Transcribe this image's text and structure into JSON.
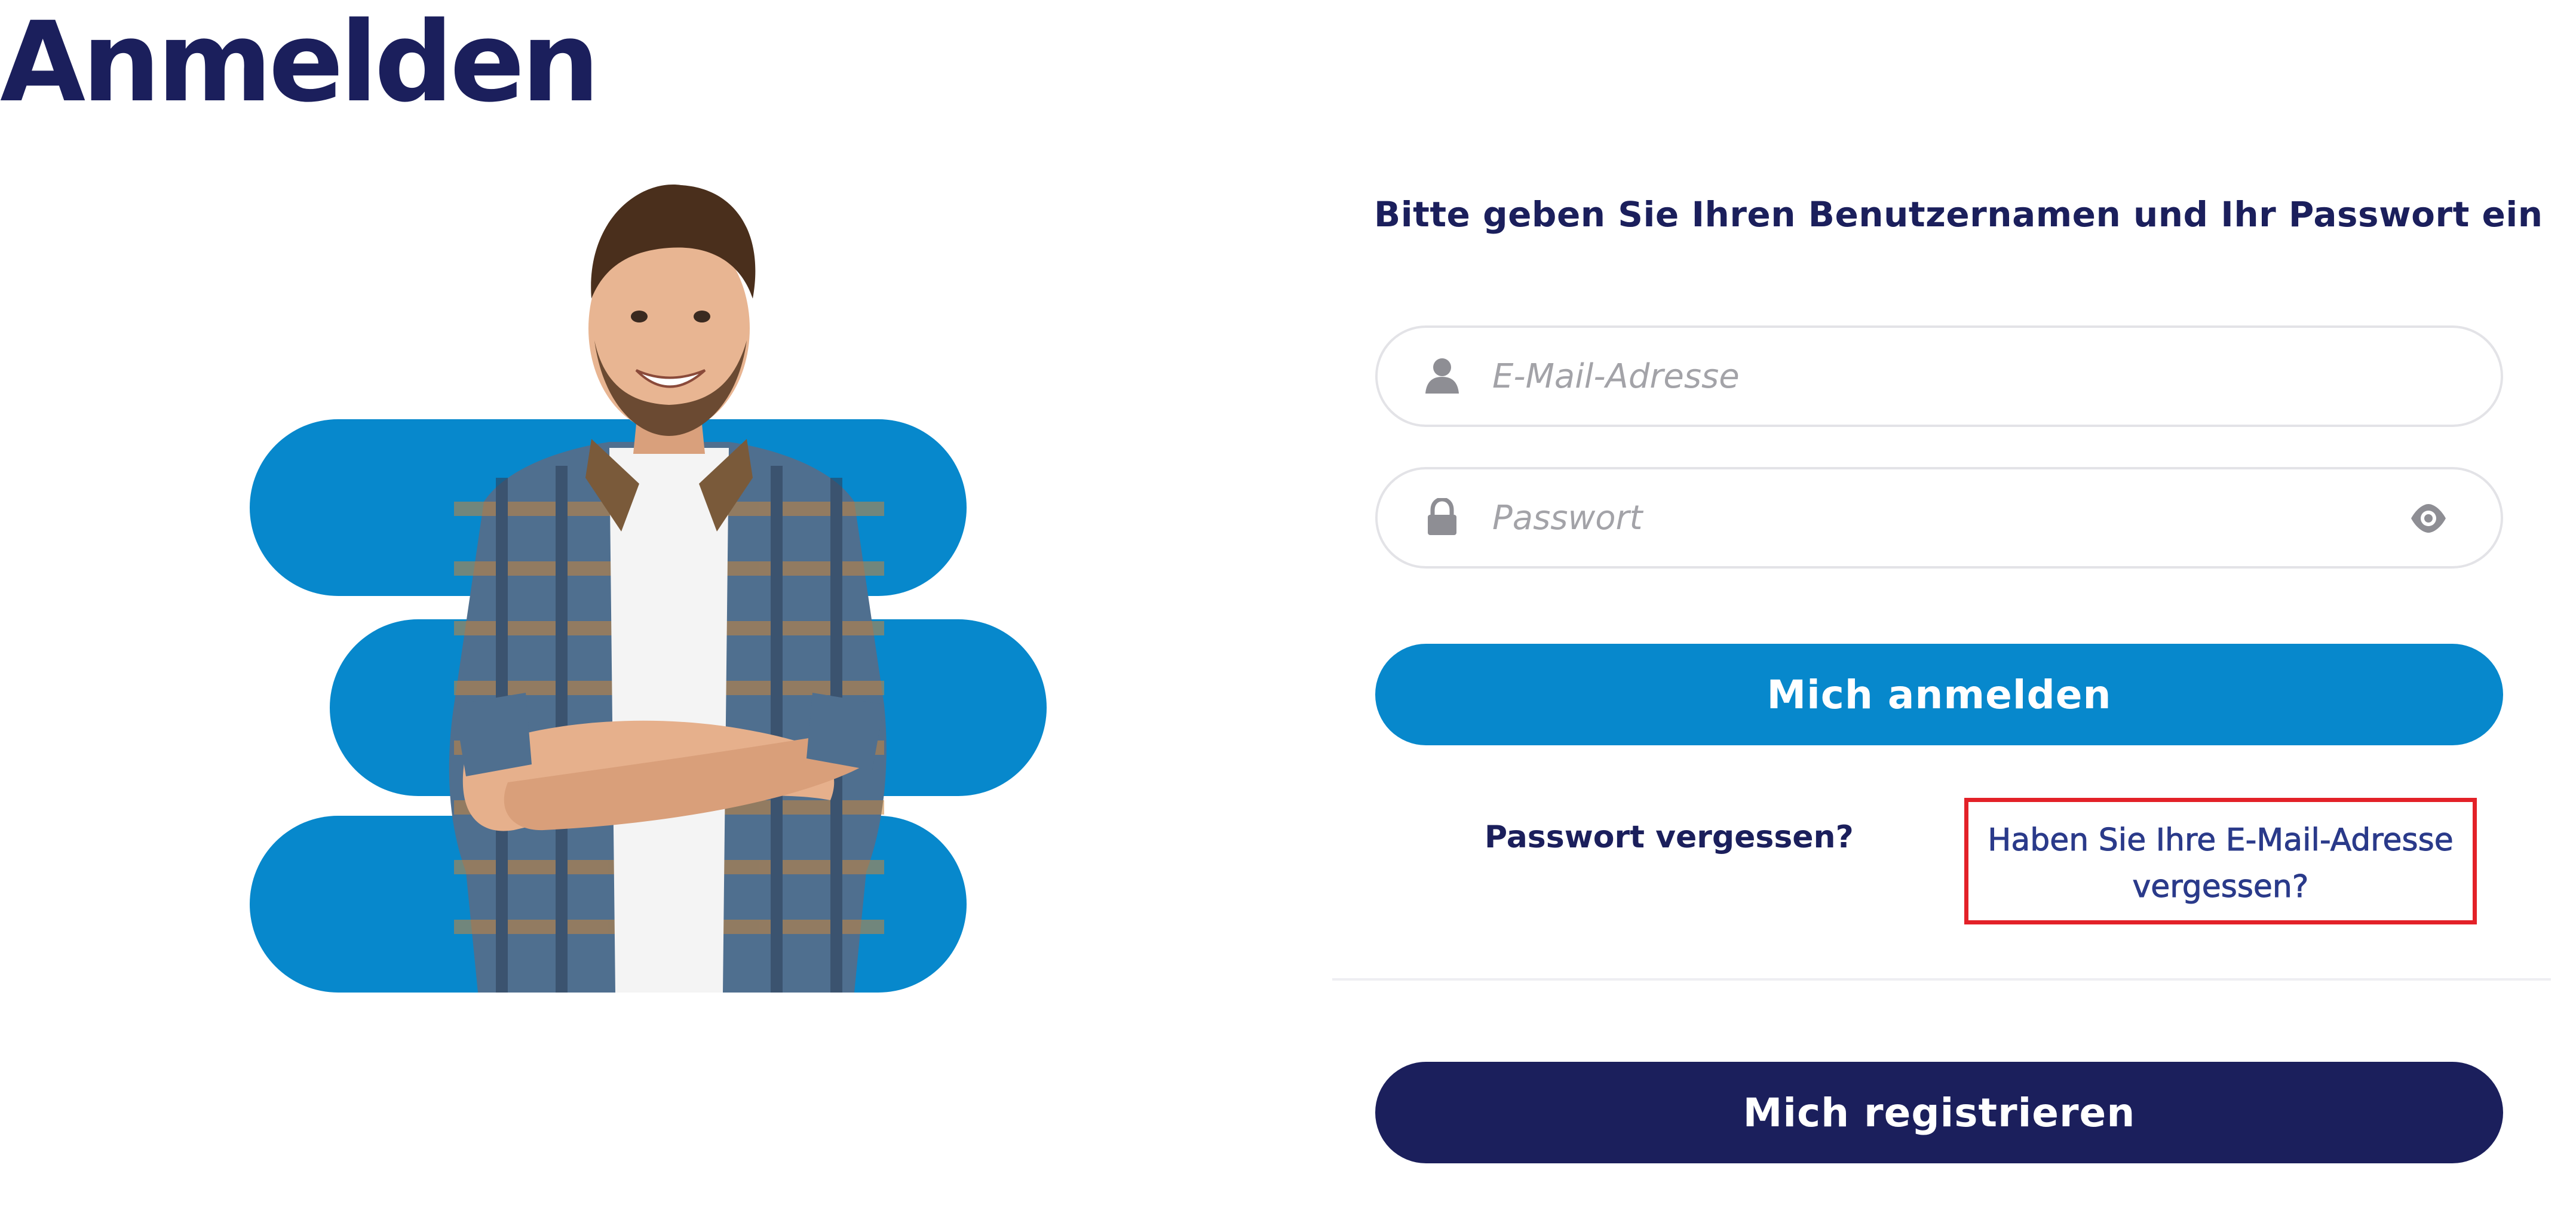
{
  "colors": {
    "navy": "#1b1f5c",
    "blue": "#0788cc",
    "link_blue": "#2a3a8a",
    "highlight_red": "#e32128"
  },
  "page": {
    "title": "Anmelden"
  },
  "form": {
    "instruction": "Bitte geben Sie Ihren Benutzernamen und Ihr Passwort ein",
    "email": {
      "placeholder": "E-Mail-Adresse",
      "value": "",
      "icon": "user-icon"
    },
    "password": {
      "placeholder": "Passwort",
      "value": "",
      "icon": "lock-icon",
      "toggle_icon": "eye-icon"
    },
    "login_button": "Mich anmelden",
    "forgot_password_link": "Passwort vergessen?",
    "forgot_email_link": "Haben Sie Ihre E-Mail-Adresse vergessen?",
    "register_button": "Mich registrieren"
  }
}
